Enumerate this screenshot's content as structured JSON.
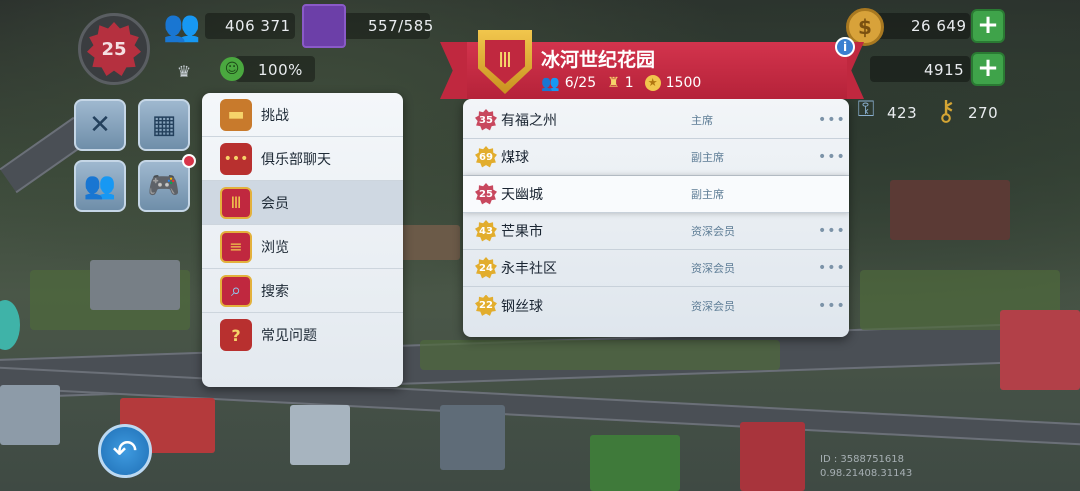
{
  "hud": {
    "level": "25",
    "population": "406 371",
    "storage": "557/585",
    "happiness": "100%",
    "simoleons": "26 649",
    "simcash": "4915",
    "golden_keys": "423",
    "platinum_keys": "270"
  },
  "menu": {
    "items": [
      {
        "label": "挑战",
        "icon": "treasure-chest-icon"
      },
      {
        "label": "俱乐部聊天",
        "icon": "chat-bubble-icon"
      },
      {
        "label": "会员",
        "icon": "club-shield-icon"
      },
      {
        "label": "浏览",
        "icon": "browse-shield-icon"
      },
      {
        "label": "搜索",
        "icon": "magnifier-icon"
      },
      {
        "label": "常见问题",
        "icon": "faq-book-icon"
      }
    ],
    "active_index": 2
  },
  "club": {
    "name": "冰河世纪花园",
    "members": "6/25",
    "wars": "1",
    "points": "1500",
    "info_symbol": "i",
    "members_list": [
      {
        "level": "35",
        "name": "有福之州",
        "role": "主席",
        "badge_color": "red",
        "more": "•••"
      },
      {
        "level": "69",
        "name": "煤球",
        "role": "副主席",
        "badge_color": "gold",
        "more": "•••"
      },
      {
        "level": "25",
        "name": "天幽城",
        "role": "副主席",
        "badge_color": "red",
        "more": ""
      },
      {
        "level": "43",
        "name": "芒果市",
        "role": "资深会员",
        "badge_color": "gold",
        "more": "•••"
      },
      {
        "level": "24",
        "name": "永丰社区",
        "role": "资深会员",
        "badge_color": "gold",
        "more": "•••"
      },
      {
        "level": "22",
        "name": "钢丝球",
        "role": "资深会员",
        "badge_color": "gold",
        "more": "•••"
      }
    ]
  },
  "footer": {
    "id_line1": "ID : 3588751618",
    "id_line2": "0.98.21408.31143"
  },
  "colors": {
    "banner": "#c0283f",
    "accent_gold": "#e2ad2d",
    "plus_green": "#3fa34a"
  }
}
